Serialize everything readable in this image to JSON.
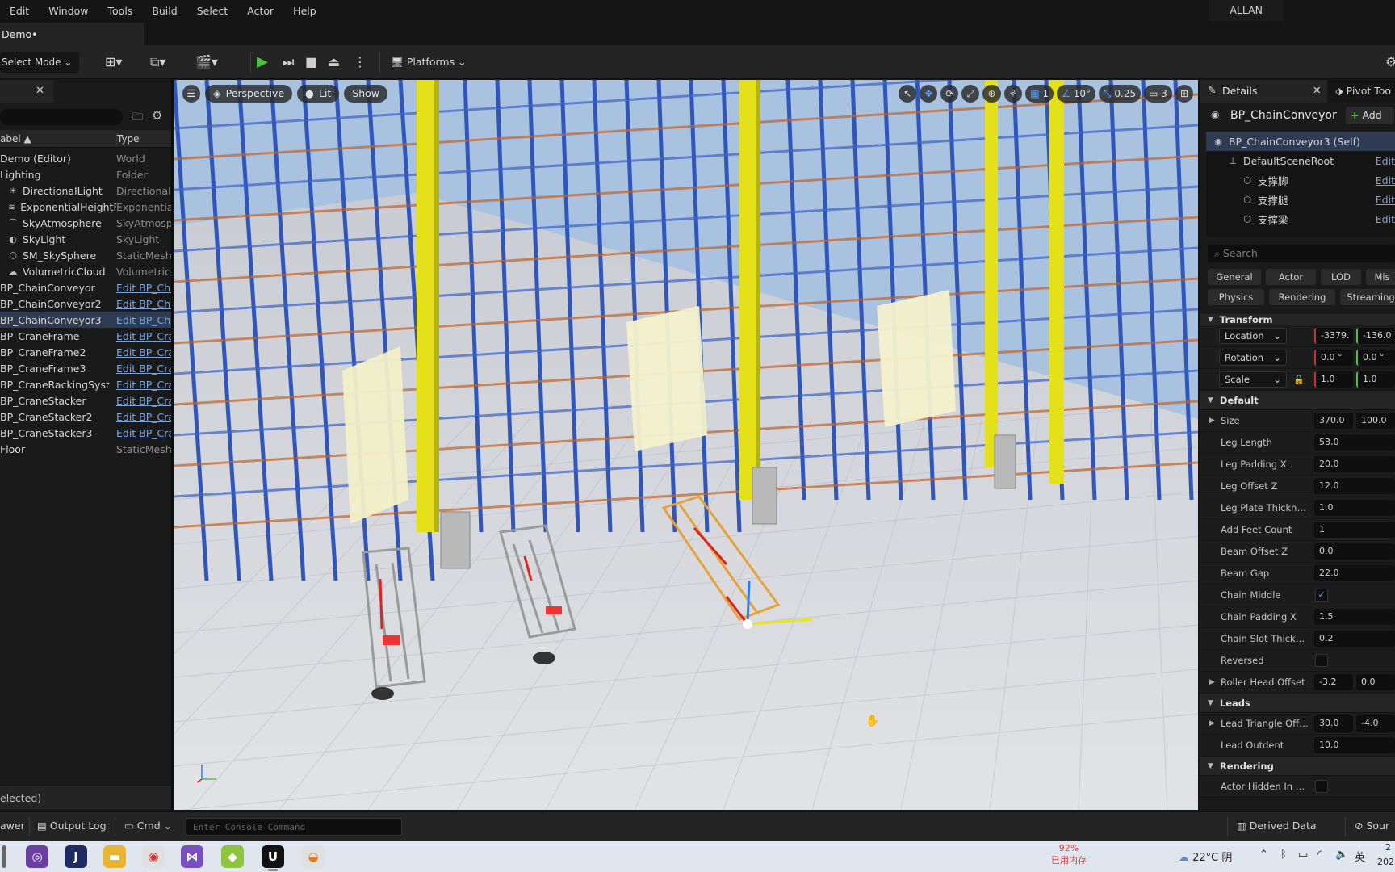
{
  "menu": [
    "Edit",
    "Window",
    "Tools",
    "Build",
    "Select",
    "Actor",
    "Help"
  ],
  "user": "ALLAN",
  "doc_tab": "Demo•",
  "toolbar": {
    "select_mode": "Select Mode",
    "platforms": "Platforms"
  },
  "outliner": {
    "col_label": "abel ▲",
    "col_type": "Type",
    "rows": [
      {
        "name": "Demo (Editor)",
        "type": "World",
        "icon": "world-icon",
        "link": false,
        "sel": false,
        "indent": 0
      },
      {
        "name": "Lighting",
        "type": "Folder",
        "icon": "folder-icon",
        "link": false,
        "sel": false,
        "indent": 0
      },
      {
        "name": "DirectionalLight",
        "type": "DirectionalL",
        "icon": "sun-icon",
        "link": false,
        "sel": false,
        "indent": 1
      },
      {
        "name": "ExponentialHeightFo",
        "type": "Exponential",
        "icon": "fog-icon",
        "link": false,
        "sel": false,
        "indent": 1
      },
      {
        "name": "SkyAtmosphere",
        "type": "SkyAtmosp",
        "icon": "atmosphere-icon",
        "link": false,
        "sel": false,
        "indent": 1
      },
      {
        "name": "SkyLight",
        "type": "SkyLight",
        "icon": "skylight-icon",
        "link": false,
        "sel": false,
        "indent": 1
      },
      {
        "name": "SM_SkySphere",
        "type": "StaticMesh",
        "icon": "mesh-icon",
        "link": false,
        "sel": false,
        "indent": 1
      },
      {
        "name": "VolumetricCloud",
        "type": "VolumetricC",
        "icon": "cloud-icon",
        "link": false,
        "sel": false,
        "indent": 1
      },
      {
        "name": "BP_ChainConveyor",
        "type": "Edit BP_Cha",
        "icon": "",
        "link": true,
        "sel": false,
        "indent": 0
      },
      {
        "name": "BP_ChainConveyor2",
        "type": "Edit BP_Cha",
        "icon": "",
        "link": true,
        "sel": false,
        "indent": 0
      },
      {
        "name": "BP_ChainConveyor3",
        "type": "Edit BP_Cha",
        "icon": "",
        "link": true,
        "sel": true,
        "indent": 0
      },
      {
        "name": "BP_CraneFrame",
        "type": "Edit BP_Cra",
        "icon": "",
        "link": true,
        "sel": false,
        "indent": 0
      },
      {
        "name": "BP_CraneFrame2",
        "type": "Edit BP_Cra",
        "icon": "",
        "link": true,
        "sel": false,
        "indent": 0
      },
      {
        "name": "BP_CraneFrame3",
        "type": "Edit BP_Cra",
        "icon": "",
        "link": true,
        "sel": false,
        "indent": 0
      },
      {
        "name": "BP_CraneRackingSyst",
        "type": "Edit BP_Cra",
        "icon": "",
        "link": true,
        "sel": false,
        "indent": 0
      },
      {
        "name": "BP_CraneStacker",
        "type": "Edit BP_Cra",
        "icon": "",
        "link": true,
        "sel": false,
        "indent": 0
      },
      {
        "name": "BP_CraneStacker2",
        "type": "Edit BP_Cra",
        "icon": "",
        "link": true,
        "sel": false,
        "indent": 0
      },
      {
        "name": "BP_CraneStacker3",
        "type": "Edit BP_Cra",
        "icon": "",
        "link": true,
        "sel": false,
        "indent": 0
      },
      {
        "name": "Floor",
        "type": "StaticMesh",
        "icon": "",
        "link": false,
        "sel": false,
        "indent": 0
      }
    ],
    "footer": "elected)"
  },
  "viewport": {
    "perspective": "Perspective",
    "lit": "Lit",
    "show": "Show",
    "grid_snap": "1",
    "rot_snap": "10°",
    "scale_snap": "0.25",
    "camera_speed": "3"
  },
  "details": {
    "tab": "Details",
    "tab2": "Pivot Too",
    "actor_name": "BP_ChainConveyor",
    "add": "Add",
    "components": [
      {
        "name": "BP_ChainConveyor3 (Self)",
        "edit": "",
        "indent": 0,
        "sel": true
      },
      {
        "name": "DefaultSceneRoot",
        "edit": "Edit",
        "indent": 1,
        "sel": false
      },
      {
        "name": "支撑脚",
        "edit": "Edit",
        "indent": 2,
        "sel": false
      },
      {
        "name": "支撑腿",
        "edit": "Edit",
        "indent": 2,
        "sel": false
      },
      {
        "name": "支撑梁",
        "edit": "Edit",
        "indent": 2,
        "sel": false
      }
    ],
    "search_placeholder": "Search",
    "filters_row1": [
      "General",
      "Actor",
      "LOD",
      "Mis"
    ],
    "filters_row2": [
      "Physics",
      "Rendering",
      "Streaming"
    ],
    "transform_section": "Transform",
    "location": {
      "label": "Location",
      "x": "-3379.",
      "y": "-136.0"
    },
    "rotation": {
      "label": "Rotation",
      "x": "0.0 °",
      "y": "0.0 °"
    },
    "scale": {
      "label": "Scale",
      "x": "1.0",
      "y": "1.0"
    },
    "default_section": "Default",
    "props": [
      {
        "label": "Size",
        "a": "370.0",
        "b": "100.0",
        "expand": true
      },
      {
        "label": "Leg Length",
        "v": "53.0"
      },
      {
        "label": "Leg Padding X",
        "v": "20.0"
      },
      {
        "label": "Leg Offset Z",
        "v": "12.0"
      },
      {
        "label": "Leg Plate Thickness",
        "v": "1.0"
      },
      {
        "label": "Add Feet Count",
        "v": "1"
      },
      {
        "label": "Beam Offset Z",
        "v": "0.0"
      },
      {
        "label": "Beam Gap",
        "v": "22.0"
      },
      {
        "label": "Chain Middle",
        "check": "✓"
      },
      {
        "label": "Chain Padding X",
        "v": "1.5"
      },
      {
        "label": "Chain Slot Thickne...",
        "v": "0.2"
      },
      {
        "label": "Reversed",
        "check": ""
      },
      {
        "label": "Roller Head Offset",
        "a": "-3.2",
        "b": "0.0",
        "expand": true
      }
    ],
    "leads_section": "Leads",
    "leads": [
      {
        "label": "Lead Triangle Offs...",
        "a": "30.0",
        "b": "-4.0",
        "expand": true
      },
      {
        "label": "Lead Outdent",
        "v": "10.0"
      }
    ],
    "rendering_section": "Rendering",
    "rendering": [
      {
        "label": "Actor Hidden In Ga...",
        "check": ""
      }
    ]
  },
  "bottom": {
    "drawer": "awer",
    "output_log": "Output Log",
    "cmd": "Cmd",
    "console_placeholder": "Enter Console Command",
    "derived_data": "Derived Data",
    "source": "Sour"
  },
  "taskbar": {
    "mem_pct": "92%",
    "mem_label": "已用内存",
    "weather": "22°C 阴",
    "ime": "英",
    "time_clip": "2",
    "date_clip": "202"
  }
}
